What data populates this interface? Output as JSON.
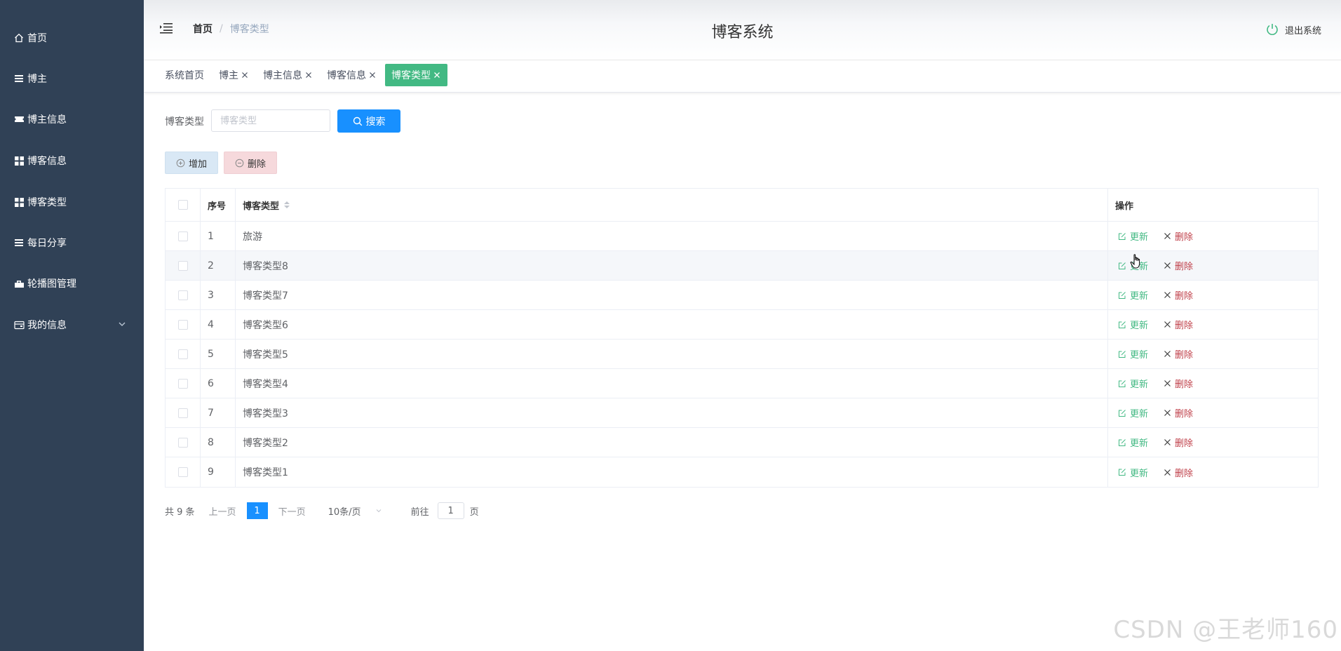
{
  "sidebar": {
    "items": [
      {
        "label": "首页",
        "icon": "home-icon"
      },
      {
        "label": "博主",
        "icon": "list-icon"
      },
      {
        "label": "博主信息",
        "icon": "ticket-icon"
      },
      {
        "label": "博客信息",
        "icon": "grid-icon"
      },
      {
        "label": "博客类型",
        "icon": "grid-icon"
      },
      {
        "label": "每日分享",
        "icon": "list-icon"
      },
      {
        "label": "轮播图管理",
        "icon": "shop-icon"
      },
      {
        "label": "我的信息",
        "icon": "wallet-icon",
        "expandable": true
      }
    ]
  },
  "header": {
    "breadcrumb_home": "首页",
    "breadcrumb_separator": "/",
    "breadcrumb_current": "博客类型",
    "title": "博客系统",
    "logout_label": "退出系统"
  },
  "tabs": [
    {
      "label": "系统首页",
      "closable": false,
      "active": false
    },
    {
      "label": "博主",
      "closable": true,
      "active": false
    },
    {
      "label": "博主信息",
      "closable": true,
      "active": false
    },
    {
      "label": "博客信息",
      "closable": true,
      "active": false
    },
    {
      "label": "博客类型",
      "closable": true,
      "active": true
    }
  ],
  "search": {
    "label": "博客类型",
    "placeholder": "博客类型",
    "value": "",
    "button_label": "搜索"
  },
  "actions": {
    "add_label": "增加",
    "delete_label": "删除"
  },
  "table": {
    "columns": {
      "index": "序号",
      "name": "博客类型",
      "operations": "操作"
    },
    "update_label": "更新",
    "delete_label": "删除",
    "rows": [
      {
        "index": "1",
        "name": "旅游"
      },
      {
        "index": "2",
        "name": "博客类型8"
      },
      {
        "index": "3",
        "name": "博客类型7"
      },
      {
        "index": "4",
        "name": "博客类型6"
      },
      {
        "index": "5",
        "name": "博客类型5"
      },
      {
        "index": "6",
        "name": "博客类型4"
      },
      {
        "index": "7",
        "name": "博客类型3"
      },
      {
        "index": "8",
        "name": "博客类型2"
      },
      {
        "index": "9",
        "name": "博客类型1"
      }
    ]
  },
  "pagination": {
    "total": "共 9 条",
    "prev": "上一页",
    "current_page": "1",
    "next": "下一页",
    "page_size": "10条/页",
    "goto_label": "前往",
    "goto_value": "1",
    "goto_suffix": "页"
  },
  "watermark": "CSDN @王老师160",
  "colors": {
    "sidebar_bg": "#304156",
    "accent_green": "#42b983",
    "primary_blue": "#1890ff",
    "danger_red": "#c0404a"
  }
}
